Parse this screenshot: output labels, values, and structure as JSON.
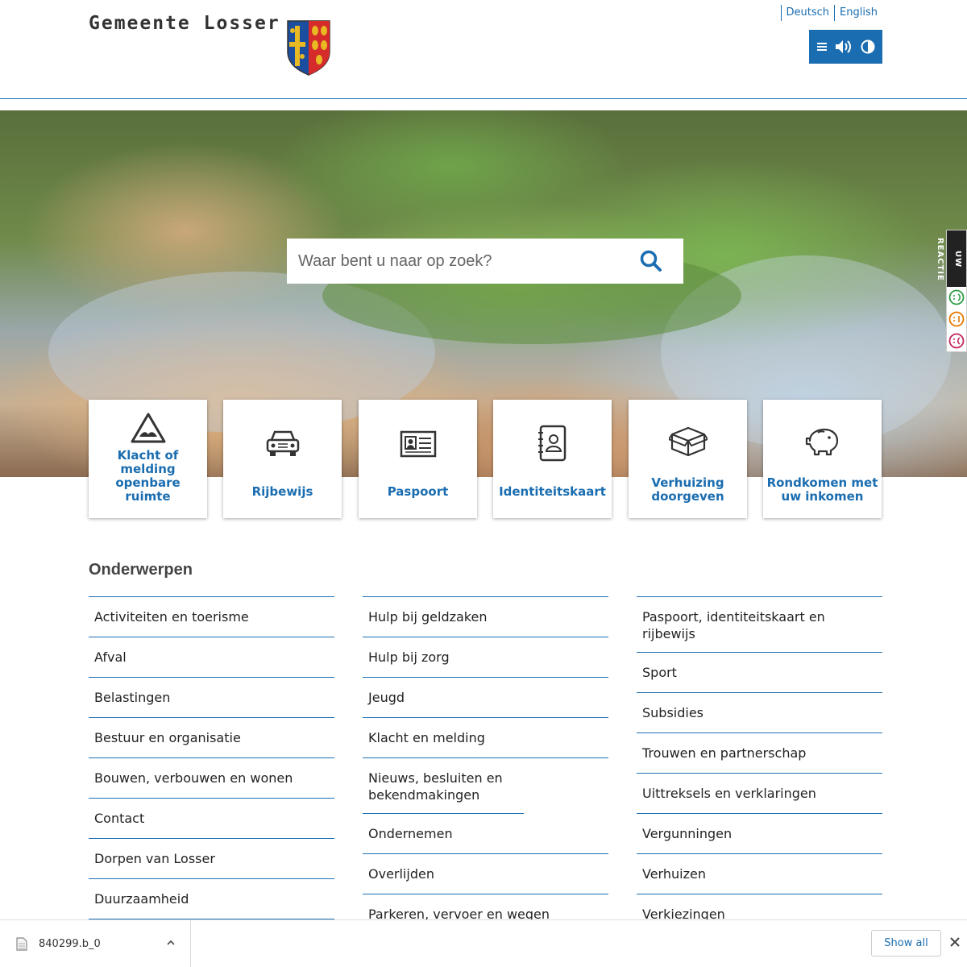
{
  "header": {
    "brand": "Gemeente Losser",
    "languages": [
      "Deutsch",
      "English"
    ],
    "toolbar_icons": [
      "menu-icon",
      "speaker-icon",
      "contrast-icon"
    ]
  },
  "hero": {
    "search_placeholder": "Waar bent u naar op zoek?",
    "search_icon": "search-icon"
  },
  "feedback": {
    "label": "UW REACTIE",
    "faces": [
      "happy-face-icon",
      "neutral-face-icon",
      "sad-face-icon"
    ]
  },
  "tiles": [
    {
      "label": "Klacht of melding openbare ruimte",
      "icon": "warning-triangle-icon"
    },
    {
      "label": "Rijbewijs",
      "icon": "car-icon"
    },
    {
      "label": "Paspoort",
      "icon": "id-card-icon"
    },
    {
      "label": "Identiteitskaart",
      "icon": "address-book-icon"
    },
    {
      "label": "Verhuizing doorgeven",
      "icon": "moving-box-icon"
    },
    {
      "label": "Rondkomen met uw inkomen",
      "icon": "piggy-bank-icon"
    }
  ],
  "topics": {
    "title": "Onderwerpen",
    "columns": [
      [
        "Activiteiten en toerisme",
        "Afval",
        "Belastingen",
        "Bestuur en organisatie",
        "Bouwen, verbouwen en wonen",
        "Contact",
        "Dorpen van Losser",
        "Duurzaamheid"
      ],
      [
        "Hulp bij geldzaken",
        "Hulp bij zorg",
        "Jeugd",
        "Klacht en melding",
        "Nieuws, besluiten en bekendmakingen",
        "Ondernemen",
        "Overlijden",
        "Parkeren, vervoer en wegen"
      ],
      [
        "Paspoort, identiteitskaart en rijbewijs",
        "Sport",
        "Subsidies",
        "Trouwen en partnerschap",
        "Uittreksels en verklaringen",
        "Vergunningen",
        "Verhuizen",
        "Verkiezingen"
      ]
    ]
  },
  "download_bar": {
    "file_name": "840299.b_0",
    "show_all": "Show all"
  },
  "colors": {
    "accent": "#1a6db0",
    "text": "#222222"
  }
}
